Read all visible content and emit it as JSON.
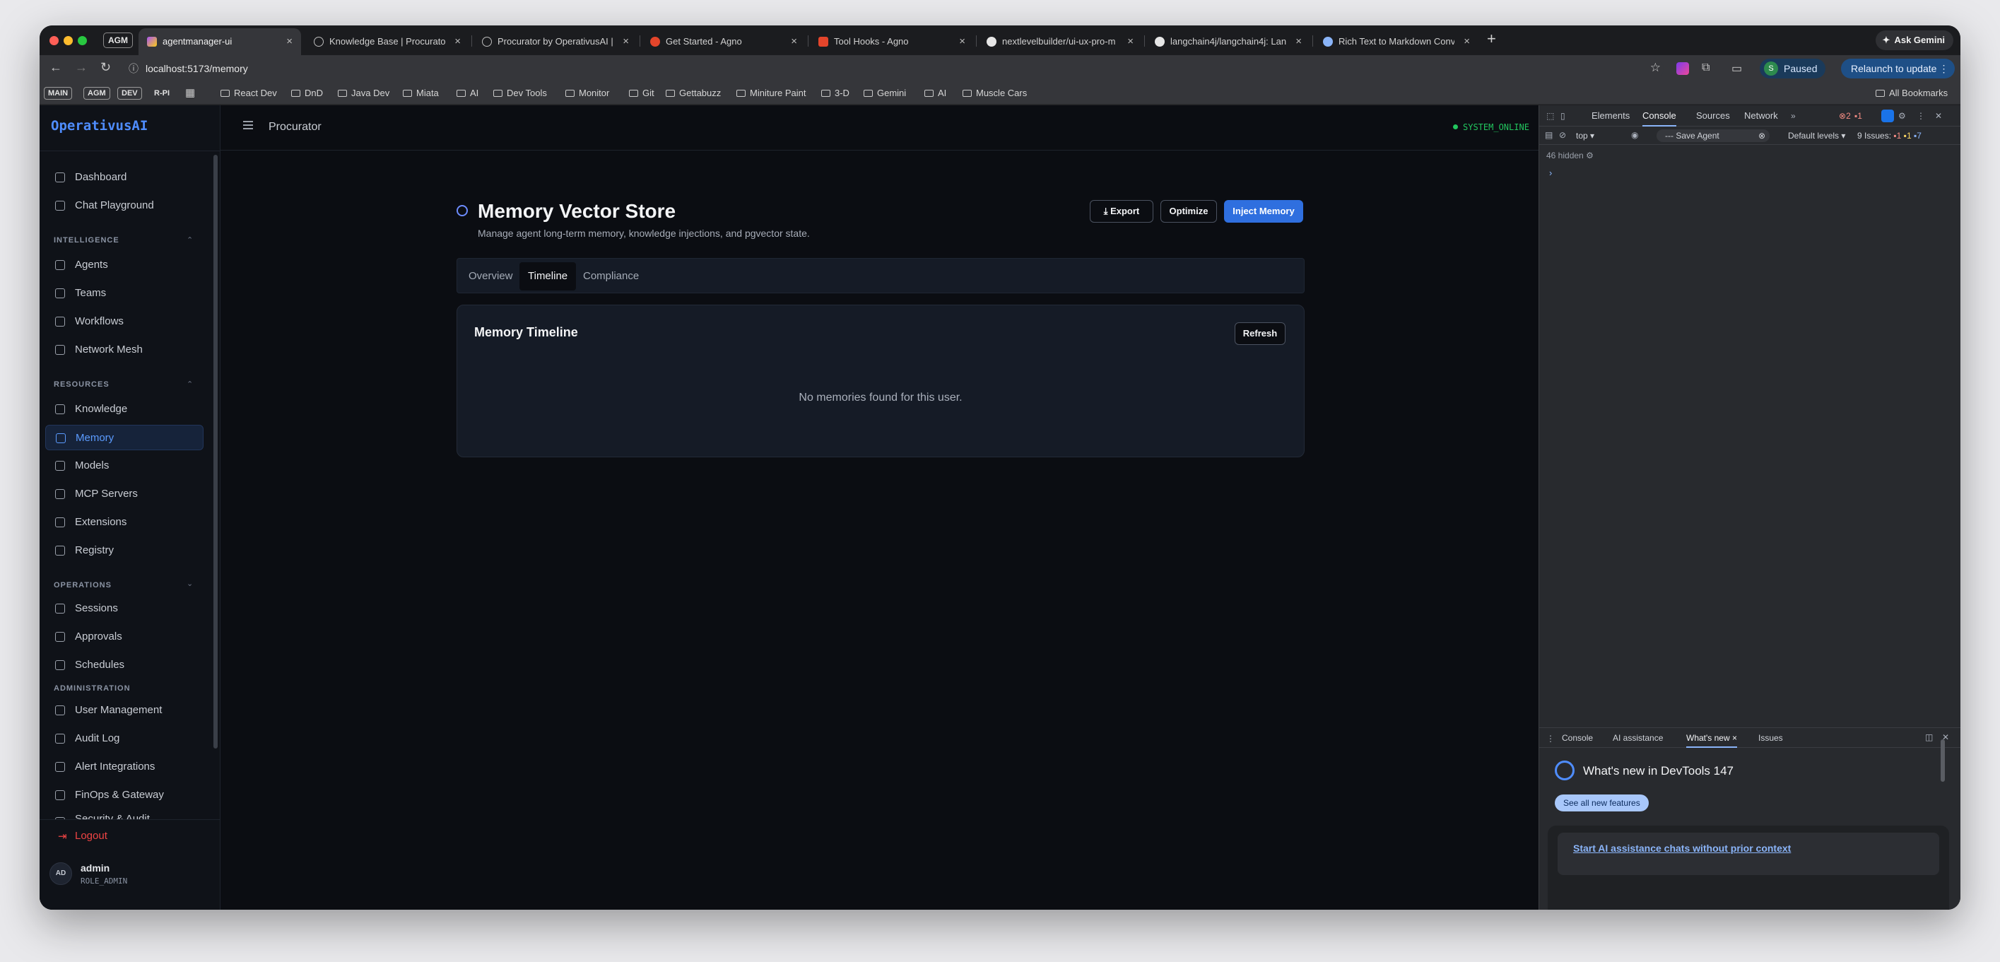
{
  "browser": {
    "profile_chip": "AGM",
    "tabs": [
      {
        "title": "agentmanager-ui",
        "active": true
      },
      {
        "title": "Knowledge Base | Procurator"
      },
      {
        "title": "Procurator by OperativusAI |"
      },
      {
        "title": "Get Started - Agno"
      },
      {
        "title": "Tool Hooks - Agno"
      },
      {
        "title": "nextlevelbuilder/ui-ux-pro-m"
      },
      {
        "title": "langchain4j/langchain4j: Lan"
      },
      {
        "title": "Rich Text to Markdown Conve"
      }
    ],
    "ask_gemini": "Ask Gemini",
    "url": "localhost:5173/memory",
    "profile_initial": "S",
    "paused_label": "Paused",
    "relaunch_label": "Relaunch to update",
    "bookmark_chips": [
      "MAIN",
      "AGM",
      "DEV",
      "R-PI"
    ],
    "bookmarks": [
      "React Dev",
      "DnD",
      "Java Dev",
      "Miata",
      "AI",
      "Dev Tools",
      "Monitor",
      "Git",
      "Gettabuzz",
      "Miniture Paint",
      "3-D",
      "Gemini",
      "AI",
      "Muscle Cars"
    ],
    "all_bookmarks": "All Bookmarks"
  },
  "app": {
    "brand": "OperativusAI",
    "header_title": "Procurator",
    "system_status": "SYSTEM_ONLINE",
    "nav": {
      "top": [
        "Dashboard",
        "Chat Playground"
      ],
      "intelligence_label": "INTELLIGENCE",
      "intelligence": [
        "Agents",
        "Teams",
        "Workflows",
        "Network Mesh"
      ],
      "resources_label": "RESOURCES",
      "resources": [
        "Knowledge",
        "Memory",
        "Models",
        "MCP Servers",
        "Extensions",
        "Registry"
      ],
      "operations_label": "OPERATIONS",
      "operations": [
        "Sessions",
        "Approvals",
        "Schedules"
      ],
      "administration_label": "ADMINISTRATION",
      "administration": [
        "User Management",
        "Audit Log",
        "Alert Integrations",
        "FinOps & Gateway",
        "Security & Audit"
      ]
    },
    "logout": "Logout",
    "user": {
      "initials": "AD",
      "name": "admin",
      "role": "ROLE_ADMIN"
    },
    "page": {
      "title": "Memory Vector Store",
      "subtitle": "Manage agent long-term memory, knowledge injections, and pgvector state.",
      "buttons": {
        "export": "Export",
        "optimize": "Optimize",
        "inject": "Inject Memory"
      },
      "tabs": [
        "Overview",
        "Timeline",
        "Compliance"
      ],
      "card_title": "Memory Timeline",
      "refresh": "Refresh",
      "empty_message": "No memories found for this user."
    }
  },
  "devtools": {
    "tabs": [
      "Elements",
      "Console",
      "Sources",
      "Network"
    ],
    "error_count": "2",
    "warning_count": "1",
    "context": "top",
    "filter_text": "--- Save Agent",
    "levels": "Default levels",
    "issues_label": "9 Issues:",
    "issues_counts": [
      "1",
      "1",
      "7"
    ],
    "hidden": "46 hidden",
    "drawer_tabs": [
      "Console",
      "AI assistance",
      "What's new",
      "Issues"
    ],
    "whats_new_title": "What's new in DevTools 147",
    "see_all": "See all new features",
    "feature_link": "Start AI assistance chats without prior context"
  },
  "colors": {
    "accent": "#2f6fdf",
    "brand": "#4f8dff",
    "online": "#22c55e",
    "logout": "#ef4444"
  }
}
